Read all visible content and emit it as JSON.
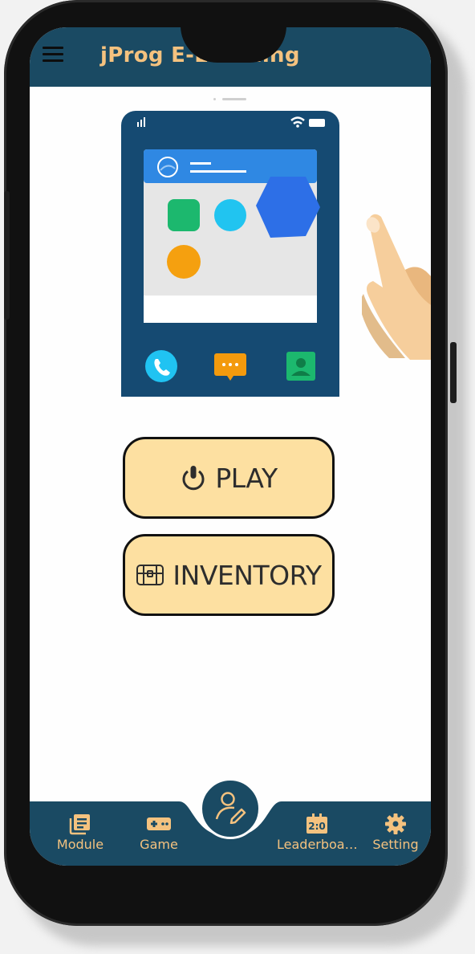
{
  "app": {
    "title": "jProg E-Learning"
  },
  "actions": {
    "play_label": "PLAY",
    "inventory_label": "INVENTORY"
  },
  "bottom_nav": {
    "items": [
      {
        "label": "Module",
        "icon": "book-icon"
      },
      {
        "label": "Game",
        "icon": "gamepad-icon"
      },
      {
        "label": "Leaderboa…",
        "icon": "scoreboard-icon"
      },
      {
        "label": "Setting",
        "icon": "gear-icon"
      }
    ],
    "center_icon": "profile-edit-icon"
  },
  "colors": {
    "bar": "#1a4a63",
    "accent": "#f4c27f",
    "button_fill": "#fde0a1"
  }
}
